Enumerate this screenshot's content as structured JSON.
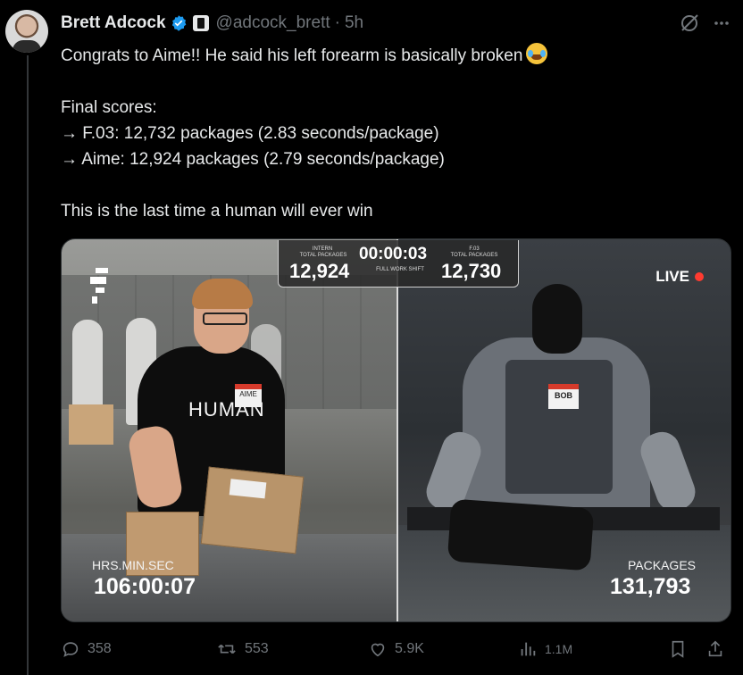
{
  "author": {
    "name": "Brett Adcock",
    "handle": "@adcock_brett",
    "separator": "·",
    "time": "5h"
  },
  "icons": {
    "verified": "verified-badge-icon",
    "affiliate": "affiliate-badge-icon",
    "grok": "grok-icon",
    "more": "more-icon",
    "reply": "reply-icon",
    "retweet": "retweet-icon",
    "like": "like-icon",
    "views": "views-icon",
    "bookmark": "bookmark-icon",
    "share": "share-icon"
  },
  "colors": {
    "verified": "#1d9bf0",
    "muted": "#71767b",
    "text": "#e7e9ea",
    "live": "#ff3b30"
  },
  "tweet": {
    "line1": "Congrats to Aime!! He said his left forearm is basically broken",
    "line2": "Final scores:",
    "line3": "→ F.03: 12,732 packages (2.83 seconds/package)",
    "line4": "→ Aime: 12,924 packages (2.79 seconds/package)",
    "line5": "This is the last time a human will ever win"
  },
  "video": {
    "scoreboard": {
      "left_caption_1": "INTERN",
      "left_caption_2": "TOTAL PACKAGES",
      "left_value": "12,924",
      "timer": "00:00:03",
      "timer_caption": "FULL WORK SHIFT",
      "right_caption_1": "F.03",
      "right_caption_2": "TOTAL PACKAGES",
      "right_value": "12,730"
    },
    "live_label": "LIVE",
    "shirt_text": "HUMAN",
    "left_name_tag": "AIME",
    "right_name_tag": "BOB",
    "bottom_left_caption": "HRS.MIN.SEC",
    "bottom_left_value": "106:00:07",
    "bottom_right_caption": "PACKAGES",
    "bottom_right_value": "131,793"
  },
  "actions": {
    "replies": "358",
    "retweets": "553",
    "likes": "5.9K",
    "views": "1.1M"
  }
}
